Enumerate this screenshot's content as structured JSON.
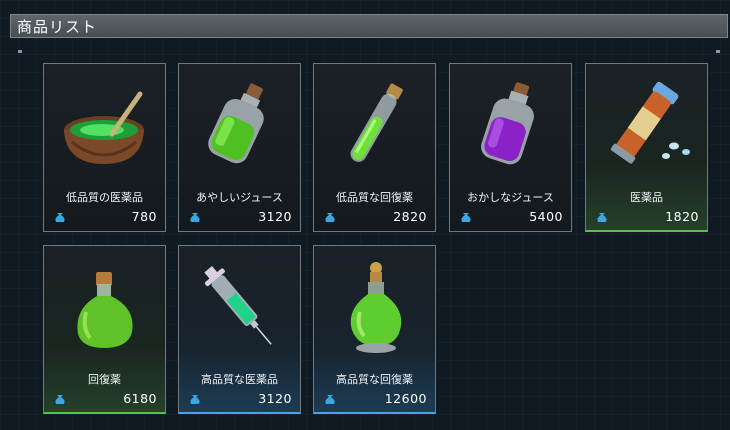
{
  "header": {
    "title": "商品リスト"
  },
  "items": [
    {
      "name": "低品質の医薬品",
      "price": "780",
      "icon": "herb-bowl-icon"
    },
    {
      "name": "あやしいジュース",
      "price": "3120",
      "icon": "green-bottle-icon"
    },
    {
      "name": "低品質な回復薬",
      "price": "2820",
      "icon": "test-tube-icon"
    },
    {
      "name": "おかしなジュース",
      "price": "5400",
      "icon": "purple-bottle-icon"
    },
    {
      "name": "医薬品",
      "price": "1820",
      "icon": "pill-tube-icon",
      "rarity_color": "#57c04b"
    },
    {
      "name": "回復薬",
      "price": "6180",
      "icon": "green-flask-icon",
      "rarity_color": "#57c04b"
    },
    {
      "name": "高品質な医薬品",
      "price": "3120",
      "icon": "syringe-icon",
      "rarity_color": "#4aa4e6"
    },
    {
      "name": "高品質な回復薬",
      "price": "12600",
      "icon": "ornate-flask-icon",
      "rarity_color": "#4aa4e6"
    }
  ],
  "colors": {
    "common_border": "#6f7980",
    "uncommon": "#57c04b",
    "rare": "#4aa4e6",
    "coin": "#3aa7e0"
  }
}
